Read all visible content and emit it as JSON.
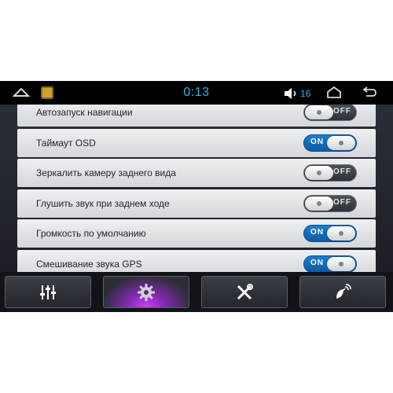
{
  "status_bar": {
    "time": "0:13",
    "volume": "16",
    "icons": [
      "back-triangle-icon",
      "app-icon",
      "speaker-icon",
      "back-arrow-icon"
    ]
  },
  "settings": [
    {
      "label": "Автозапуск навигации",
      "state": "off",
      "state_text": "OFF"
    },
    {
      "label": "Таймаут OSD",
      "state": "on",
      "state_text": "ON"
    },
    {
      "label": "Зеркалить камеру заднего вида",
      "state": "off",
      "state_text": "OFF"
    },
    {
      "label": "Глушить звук при заднем ходе",
      "state": "off",
      "state_text": "OFF"
    },
    {
      "label": "Громкость по умолчанию",
      "state": "on",
      "state_text": "ON"
    },
    {
      "label": "Смешивание звука GPS",
      "state": "on",
      "state_text": "ON"
    }
  ],
  "bottom_tabs": [
    {
      "icon": "equalizer-icon",
      "active": false
    },
    {
      "icon": "gear-icon",
      "active": true
    },
    {
      "icon": "tools-icon",
      "active": false
    },
    {
      "icon": "satellite-icon",
      "active": false
    }
  ],
  "colors": {
    "accent": "#33b5e5",
    "toggle_on": "#1d7fd0",
    "active_glow": "#d23bff"
  }
}
